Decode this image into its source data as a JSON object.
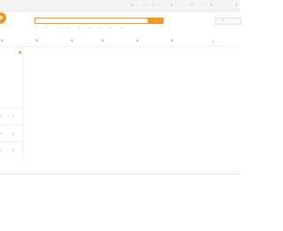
{
  "topbar": {
    "greeting": "?",
    "login_link": "?",
    "register_link": "?",
    "my_orders": "?",
    "my_account": "?",
    "business_center": "?",
    "sitemap": "?"
  },
  "search": {
    "placeholder": "?",
    "button_label": "?",
    "hot_terms": [
      "?",
      "?",
      "?",
      "?",
      "?",
      "?",
      "?",
      "?",
      "?"
    ]
  },
  "cart": {
    "label": "?"
  },
  "nav": {
    "items": [
      "?",
      "?",
      "?",
      "?",
      "?",
      "?"
    ],
    "extra": "?"
  },
  "sidebar": {
    "categories": [
      {
        "left": "?",
        "right": "?"
      },
      {
        "left": "?",
        "right": "?"
      },
      {
        "left": "?",
        "right": "?"
      }
    ]
  },
  "colors": {
    "accent": "#f7941d"
  }
}
